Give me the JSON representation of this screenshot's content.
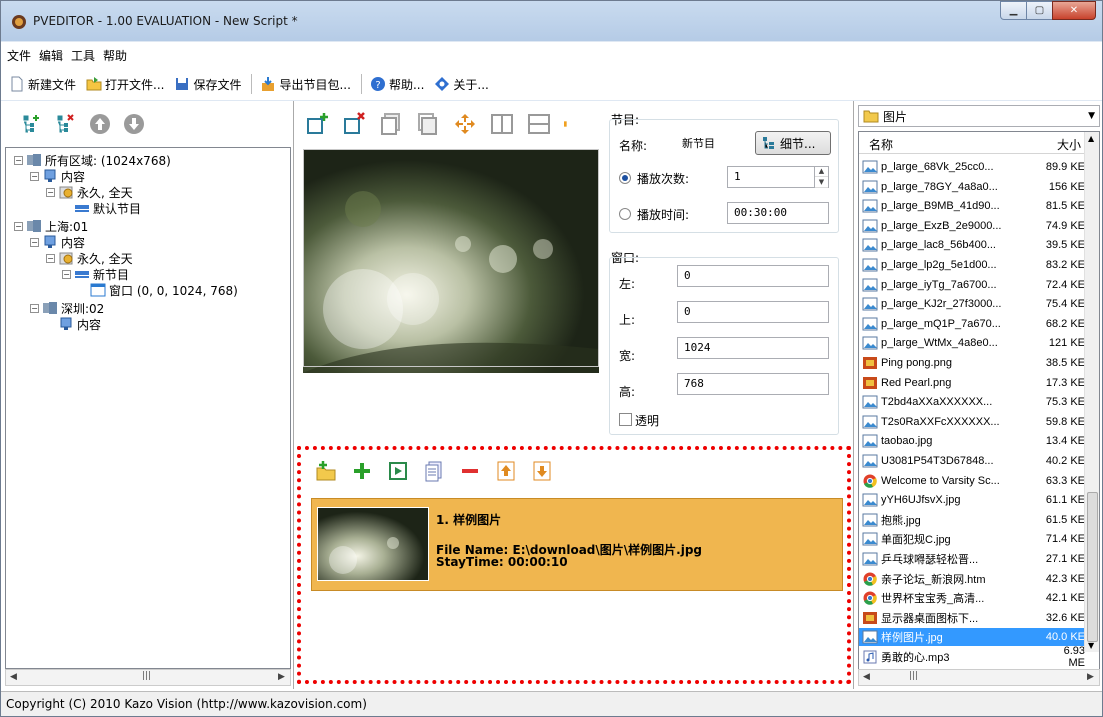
{
  "window": {
    "title": "PVEDITOR - 1.00 EVALUATION - New Script *",
    "controls": [
      "minimize",
      "maximize",
      "close"
    ]
  },
  "menubar": [
    "文件",
    "编辑",
    "工具",
    "帮助"
  ],
  "toolbar": {
    "new_file": "新建文件",
    "open_file": "打开文件...",
    "save_file": "保存文件",
    "export": "导出节目包...",
    "help": "帮助...",
    "about": "关于..."
  },
  "tree": {
    "nodes": [
      {
        "label": "所有区域:  (1024x768)",
        "icon": "region-icon",
        "expander": "−"
      },
      {
        "label": "内容",
        "icon": "monitor-icon",
        "expander": "−"
      },
      {
        "label": "永久, 全天",
        "icon": "schedule-icon",
        "expander": "−"
      },
      {
        "label": "默认节目",
        "icon": "program-icon",
        "expander": ""
      },
      {
        "label": "上海:01",
        "icon": "region-icon",
        "expander": "−"
      },
      {
        "label": "内容",
        "icon": "monitor-icon",
        "expander": "−"
      },
      {
        "label": "永久, 全天",
        "icon": "schedule-icon",
        "expander": "−"
      },
      {
        "label": "新节目",
        "icon": "program-icon",
        "expander": "−"
      },
      {
        "label": "窗口  (0, 0, 1024, 768)",
        "icon": "window-icon",
        "expander": ""
      },
      {
        "label": "深圳:02",
        "icon": "region-icon",
        "expander": "−"
      },
      {
        "label": "内容",
        "icon": "monitor-icon",
        "expander": ""
      }
    ]
  },
  "program": {
    "group_label": "节目:",
    "name_label": "名称:",
    "name_value": "新节目",
    "detail_button": "细节...",
    "play_count_label": "播放次数:",
    "play_count_value": "1",
    "play_time_label": "播放时间:",
    "play_time_value": "00:30:00"
  },
  "window_props": {
    "group_label": "窗口:",
    "left_label": "左:",
    "left_value": "0",
    "top_label": "上:",
    "top_value": "0",
    "width_label": "宽:",
    "width_value": "1024",
    "height_label": "高:",
    "height_value": "768",
    "transparent_label": "透明"
  },
  "playlist": {
    "items": [
      {
        "title": "1. 样例图片",
        "file": "File Name: E:\\download\\图片\\样例图片.jpg",
        "stay": "StayTime: 00:00:10"
      }
    ]
  },
  "files": {
    "folder": "图片",
    "col_name": "名称",
    "col_size": "大小",
    "rows": [
      {
        "name": "p_large_68Vk_25cc0...",
        "size": "89.9 KE",
        "type": "image"
      },
      {
        "name": "p_large_78GY_4a8a0...",
        "size": "156 KE",
        "type": "image"
      },
      {
        "name": "p_large_B9MB_41d90...",
        "size": "81.5 KE",
        "type": "image"
      },
      {
        "name": "p_large_ExzB_2e9000...",
        "size": "74.9 KE",
        "type": "image"
      },
      {
        "name": "p_large_lac8_56b400...",
        "size": "39.5 KE",
        "type": "image"
      },
      {
        "name": "p_large_lp2g_5e1d00...",
        "size": "83.2 KE",
        "type": "image"
      },
      {
        "name": "p_large_iyTg_7a6700...",
        "size": "72.4 KE",
        "type": "image"
      },
      {
        "name": "p_large_KJ2r_27f3000...",
        "size": "75.4 KE",
        "type": "image"
      },
      {
        "name": "p_large_mQ1P_7a670...",
        "size": "68.2 KE",
        "type": "image"
      },
      {
        "name": "p_large_WtMx_4a8e0...",
        "size": "121 KE",
        "type": "image"
      },
      {
        "name": "Ping pong.png",
        "size": "38.5 KE",
        "type": "png"
      },
      {
        "name": "Red Pearl.png",
        "size": "17.3 KE",
        "type": "png"
      },
      {
        "name": "T2bd4aXXaXXXXXX...",
        "size": "75.3 KE",
        "type": "image"
      },
      {
        "name": "T2s0RaXXFcXXXXXX...",
        "size": "59.8 KE",
        "type": "image"
      },
      {
        "name": "taobao.jpg",
        "size": "13.4 KE",
        "type": "image"
      },
      {
        "name": "U3081P54T3D67848...",
        "size": "40.2 KE",
        "type": "image"
      },
      {
        "name": "Welcome to Varsity Sc...",
        "size": "63.3 KE",
        "type": "chrome"
      },
      {
        "name": "yYH6UJfsvX.jpg",
        "size": "61.1 KE",
        "type": "image"
      },
      {
        "name": "抱熊.jpg",
        "size": "61.5 KE",
        "type": "image"
      },
      {
        "name": "单面犯规C.jpg",
        "size": "71.4 KE",
        "type": "image"
      },
      {
        "name": "乒乓球嘚瑟轻松晋...",
        "size": "27.1 KE",
        "type": "image"
      },
      {
        "name": "亲子论坛_新浪网.htm",
        "size": "42.3 KE",
        "type": "chrome"
      },
      {
        "name": "世界杯宝宝秀_高清...",
        "size": "42.1 KE",
        "type": "chrome"
      },
      {
        "name": "显示器桌面图标下...",
        "size": "32.6 KE",
        "type": "png"
      },
      {
        "name": "样例图片.jpg",
        "size": "40.0 KE",
        "type": "image",
        "selected": true
      },
      {
        "name": "勇敢的心.mp3",
        "size": "6.93 ME",
        "type": "audio"
      }
    ]
  },
  "status": "Copyright (C) 2010 Kazo Vision (http://www.kazovision.com)",
  "colors": {
    "playlist_item_bg": "#f0b64f",
    "selection": "#3399ff",
    "highlight_border": "#ee0000"
  }
}
